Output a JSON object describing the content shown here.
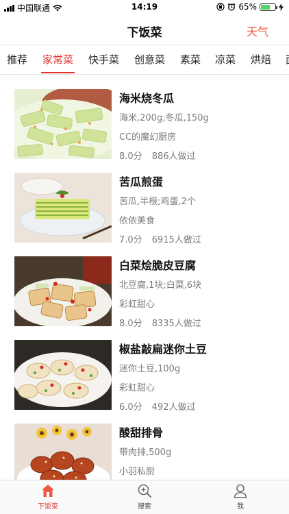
{
  "status_bar": {
    "carrier": "中国联通",
    "time": "14:19",
    "battery_percent": "65%",
    "battery_level": 0.65
  },
  "nav": {
    "title": "下饭菜",
    "right_button": "天气"
  },
  "tabs": [
    {
      "label": "推荐",
      "active": false
    },
    {
      "label": "家常菜",
      "active": true
    },
    {
      "label": "快手菜",
      "active": false
    },
    {
      "label": "创意菜",
      "active": false
    },
    {
      "label": "素菜",
      "active": false
    },
    {
      "label": "凉菜",
      "active": false
    },
    {
      "label": "烘焙",
      "active": false
    },
    {
      "label": "面",
      "active": false
    }
  ],
  "recipes": [
    {
      "title": "海米烧冬瓜",
      "ingredients": "海米,200g;冬瓜,150g",
      "author": "CC的魔幻厨房",
      "score": "8.0分",
      "made": "886人做过"
    },
    {
      "title": "苦瓜煎蛋",
      "ingredients": "苦瓜,半根;鸡蛋,2个",
      "author": "依依美食",
      "score": "7.0分",
      "made": "6915人做过"
    },
    {
      "title": "白菜烩脆皮豆腐",
      "ingredients": "北豆腐,1块;白菜,6块",
      "author": "彩虹甜心",
      "score": "8.0分",
      "made": "8335人做过"
    },
    {
      "title": "椒盐敲扁迷你土豆",
      "ingredients": "迷你土豆,100g",
      "author": "彩虹甜心",
      "score": "6.0分",
      "made": "492人做过"
    },
    {
      "title": "酸甜排骨",
      "ingredients": "带肉排,500g",
      "author": "小羽私厨",
      "score": "",
      "made": ""
    }
  ],
  "tabbar": [
    {
      "label": "下饭菜",
      "icon": "home-icon",
      "active": true
    },
    {
      "label": "搜索",
      "icon": "search-icon",
      "active": false
    },
    {
      "label": "我",
      "icon": "profile-icon",
      "active": false
    }
  ],
  "colors": {
    "accent": "#e5302c",
    "weather": "#f25a3c",
    "secondary_text": "#7a7a7a"
  }
}
